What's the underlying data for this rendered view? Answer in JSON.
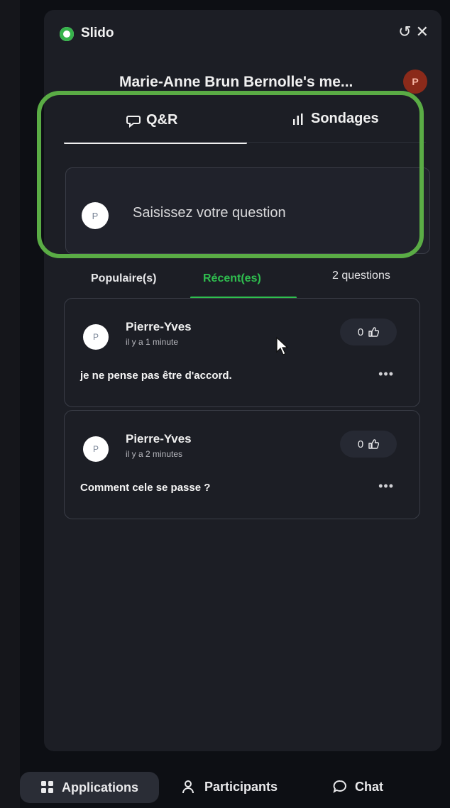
{
  "app": {
    "name": "Slido",
    "brand_color": "#35b24a"
  },
  "header": {
    "history_icon": "history-icon",
    "close_icon": "close-icon"
  },
  "meeting": {
    "title": "Marie-Anne Brun Bernolle's me...",
    "host_initial": "P"
  },
  "tabs": [
    {
      "label": "Q&R",
      "icon": "speech-bubble-icon",
      "active": true
    },
    {
      "label": "Sondages",
      "icon": "bar-chart-icon",
      "active": false
    }
  ],
  "ask": {
    "avatar_initial": "P",
    "placeholder": "Saisissez votre question"
  },
  "filters": {
    "popular": "Populaire(s)",
    "recent": "Récent(es)",
    "count": "2 questions",
    "active_color": "#2fbf4f"
  },
  "questions": [
    {
      "initial": "P",
      "author": "Pierre-Yves",
      "time": "il y a 1 minute",
      "likes": "0",
      "text": "je ne pense pas être d'accord.",
      "more": "•••"
    },
    {
      "initial": "P",
      "author": "Pierre-Yves",
      "time": "il y a 2 minutes",
      "likes": "0",
      "text": "Comment cele se passe ?",
      "more": "•••"
    }
  ],
  "bottom_bar": {
    "apps": "Applications",
    "participants": "Participants",
    "chat": "Chat"
  },
  "annotation": {
    "highlight_color": "#5aac45"
  }
}
